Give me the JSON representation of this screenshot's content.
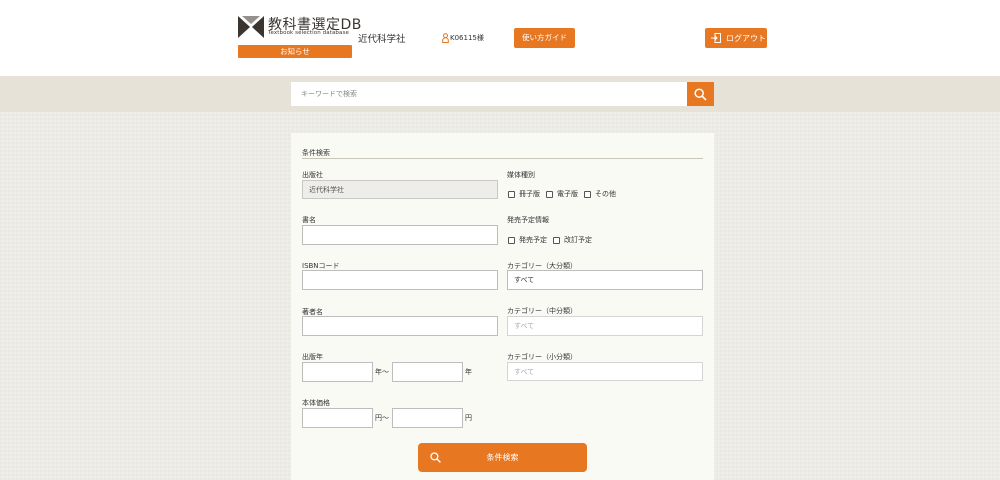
{
  "header": {
    "logo_title": "教科書選定DB",
    "logo_subtitle": "Textbook selection database",
    "notice_label": "お知らせ",
    "company": "近代科学社",
    "user": "K06115様",
    "guide_label": "使い方ガイド",
    "logout_label": "ログアウト"
  },
  "search": {
    "placeholder": "キーワードで検索"
  },
  "form": {
    "title": "条件検索",
    "publisher_label": "出版社",
    "publisher_value": "近代科学社",
    "media_label": "媒体種別",
    "media_options": [
      "冊子版",
      "電子版",
      "その他"
    ],
    "book_title_label": "書名",
    "release_label": "発売予定情報",
    "release_options": [
      "発売予定",
      "改訂予定"
    ],
    "isbn_label": "ISBNコード",
    "category_large_label": "カテゴリー（大分類）",
    "category_large_value": "すべて",
    "author_label": "著者名",
    "category_mid_label": "カテゴリー（中分類）",
    "category_mid_value": "すべて",
    "pub_year_label": "出版年",
    "year_from_unit": "年〜",
    "year_to_unit": "年",
    "category_small_label": "カテゴリー（小分類）",
    "category_small_value": "すべて",
    "price_label": "本体価格",
    "price_from_unit": "円〜",
    "price_to_unit": "円",
    "submit_label": "条件検索"
  },
  "colors": {
    "accent": "#e87722",
    "band": "#e6e2d8",
    "panel": "#fafaf5"
  }
}
